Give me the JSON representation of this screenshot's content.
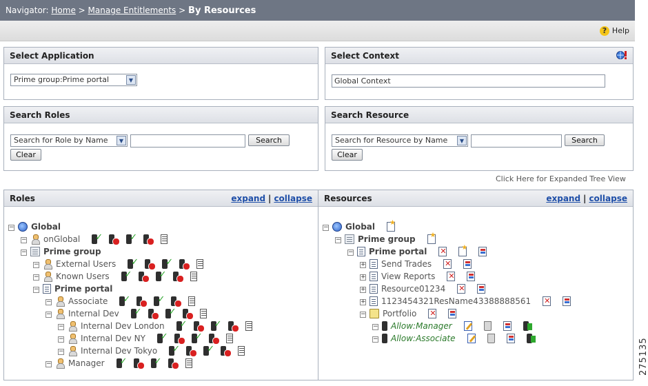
{
  "navigator": {
    "label": "Navigator:",
    "crumbs": [
      "Home",
      "Manage Entitlements"
    ],
    "sep": ">",
    "current": "By Resources"
  },
  "help": {
    "label": "Help"
  },
  "select_application": {
    "title": "Select Application",
    "selected": "Prime group:Prime portal"
  },
  "select_context": {
    "title": "Select Context",
    "value": "Global Context"
  },
  "search_roles": {
    "title": "Search Roles",
    "selected": "Search for Role by Name",
    "search_label": "Search",
    "clear_label": "Clear"
  },
  "search_resource": {
    "title": "Search Resource",
    "selected": "Search for Resource by Name",
    "search_label": "Search",
    "clear_label": "Clear"
  },
  "expanded_link": "Click Here for Expanded Tree View",
  "roles_panel": {
    "title": "Roles",
    "expand": "expand",
    "collapse": "collapse",
    "sep": "|",
    "nodes": [
      "Global",
      "onGlobal",
      "Prime group",
      "External Users",
      "Known Users",
      "Prime portal",
      "Associate",
      "Internal Dev",
      "Internal Dev London",
      "Internal Dev NY",
      "Internal Dev Tokyo",
      "Manager"
    ]
  },
  "resources_panel": {
    "title": "Resources",
    "expand": "expand",
    "collapse": "collapse",
    "sep": "|",
    "nodes": [
      "Global",
      "Prime group",
      "Prime portal",
      "Send Trades",
      "View Reports",
      "Resource01234",
      "1123454321ResName43388888561",
      "Portfolio",
      "Allow:Manager",
      "Allow:Associate"
    ]
  },
  "side_number": "275135"
}
